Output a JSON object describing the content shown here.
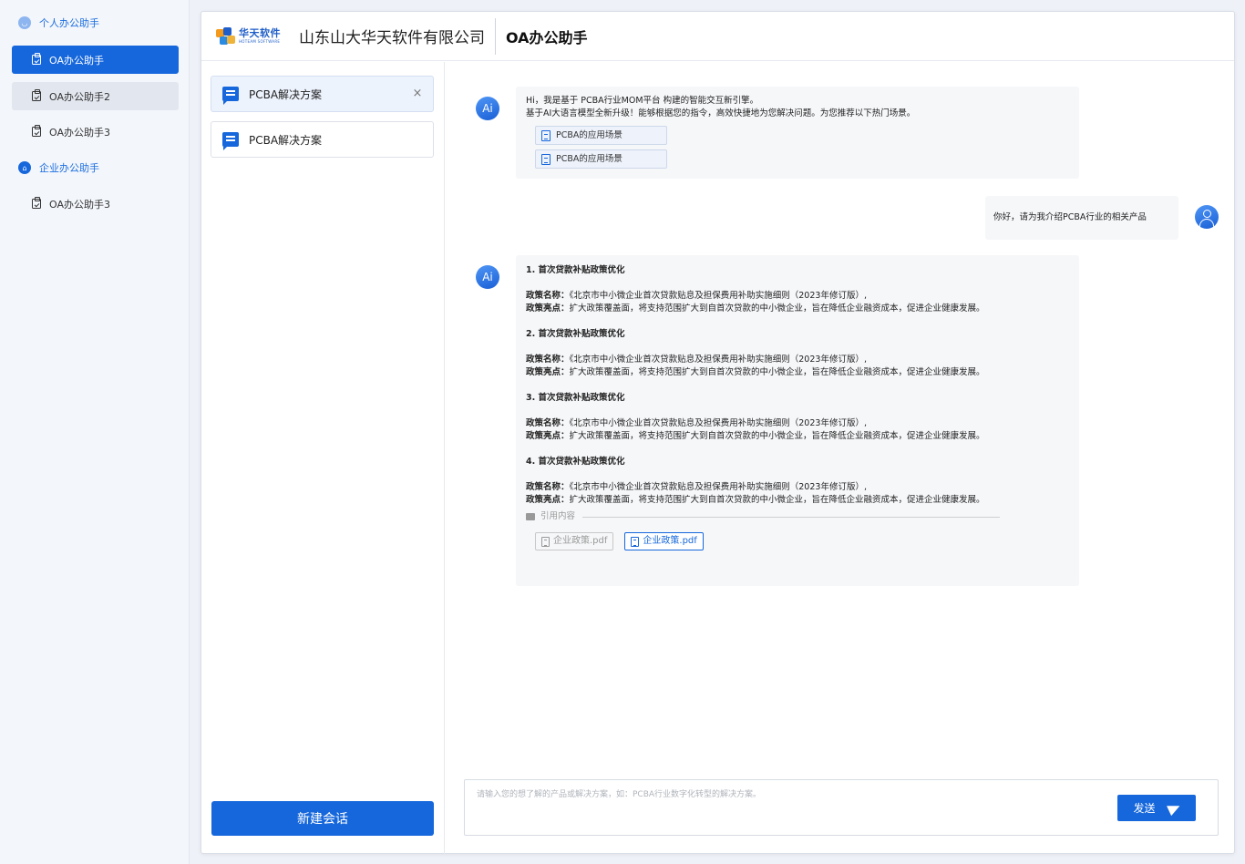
{
  "sidebar": {
    "groups": [
      {
        "label": "个人办公助手",
        "items": [
          {
            "label": "OA办公助手",
            "state": "active"
          },
          {
            "label": "OA办公助手2",
            "state": "hover"
          },
          {
            "label": "OA办公助手3",
            "state": "normal"
          }
        ]
      },
      {
        "label": "企业办公助手",
        "items": [
          {
            "label": "OA办公助手3",
            "state": "normal"
          }
        ]
      }
    ]
  },
  "header": {
    "logo_cn": "华天软件",
    "logo_en": "HOTEAM SOFTWARE",
    "company": "山东山大华天软件有限公司",
    "app_title": "OA办公助手"
  },
  "sessions": {
    "items": [
      {
        "label": "PCBA解决方案",
        "active": true,
        "close": "×"
      },
      {
        "label": "PCBA解决方案",
        "active": false
      }
    ],
    "new_button": "新建会话"
  },
  "chat": {
    "ai_avatar": "Ai",
    "greeting": {
      "line1": "Hi，我是基于  PCBA行业MOM平台   构建的智能交互新引擎。",
      "line2": "基于AI大语言模型全新升级！能够根据您的指令，高效快捷地为您解决问题。为您推荐以下热门场景。",
      "scenes": [
        "PCBA的应用场景",
        "PCBA的应用场景"
      ]
    },
    "user_message": "你好，请为我介绍PCBA行业的相关产品",
    "answer": {
      "sections": [
        {
          "heading": "1. 首次贷款补贴政策优化",
          "name_label": "政策名称：",
          "name": "《北京市中小微企业首次贷款贴息及担保费用补助实施细则（2023年修订版）,",
          "high_label": "政策亮点：",
          "high": "扩大政策覆盖面，将支持范围扩大到自首次贷款的中小微企业，旨在降低企业融资成本，促进企业健康发展。"
        },
        {
          "heading": "2. 首次贷款补贴政策优化",
          "name_label": "政策名称：",
          "name": "《北京市中小微企业首次贷款贴息及担保费用补助实施细则（2023年修订版）,",
          "high_label": "政策亮点：",
          "high": "扩大政策覆盖面，将支持范围扩大到自首次贷款的中小微企业，旨在降低企业融资成本，促进企业健康发展。"
        },
        {
          "heading": "3. 首次贷款补贴政策优化",
          "name_label": "政策名称：",
          "name": "《北京市中小微企业首次贷款贴息及担保费用补助实施细则（2023年修订版）,",
          "high_label": "政策亮点：",
          "high": "扩大政策覆盖面，将支持范围扩大到自首次贷款的中小微企业，旨在降低企业融资成本，促进企业健康发展。"
        },
        {
          "heading": "4. 首次贷款补贴政策优化",
          "name_label": "政策名称：",
          "name": "《北京市中小微企业首次贷款贴息及担保费用补助实施细则（2023年修订版）,",
          "high_label": "政策亮点：",
          "high": "扩大政策覆盖面，将支持范围扩大到自首次贷款的中小微企业，旨在降低企业融资成本，促进企业健康发展。"
        }
      ],
      "citation_label": "引用内容",
      "files": [
        {
          "label": "企业政策.pdf",
          "selected": false
        },
        {
          "label": "企业政策.pdf",
          "selected": true
        }
      ]
    }
  },
  "input": {
    "placeholder": "请输入您的想了解的产品或解决方案，如：PCBA行业数字化转型的解决方案。",
    "value": "",
    "send_label": "发送"
  },
  "colors": {
    "accent": "#1667dc",
    "sidebar_bg": "#f3f6fb",
    "bubble_bg": "#f6f7f9"
  }
}
